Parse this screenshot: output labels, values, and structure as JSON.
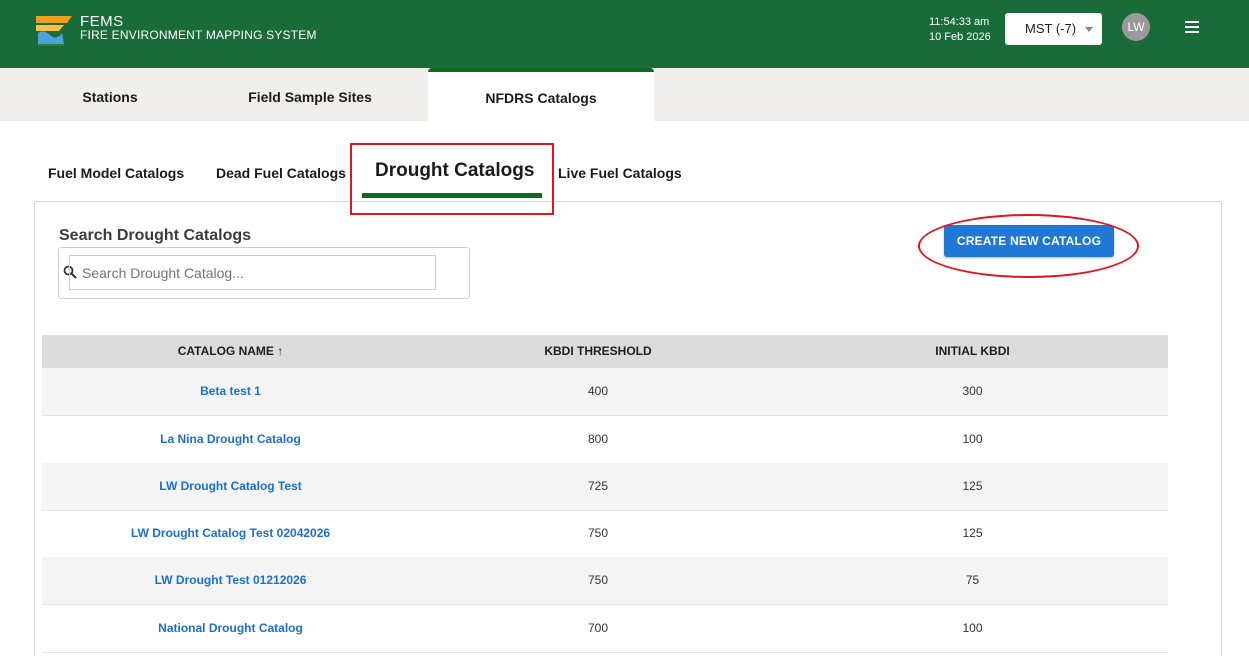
{
  "app": {
    "acronym": "FEMS",
    "full_name": "FIRE ENVIRONMENT MAPPING SYSTEM",
    "time": "11:54:33 am",
    "date": "10 Feb 2026",
    "timezone": "MST (-7)",
    "user_initials": "LW",
    "colors": {
      "header": "#1a6b3a",
      "accent": "#0b6b1f",
      "button": "#1f77d6",
      "link": "#1d6fce",
      "highlight": "#e0161c"
    }
  },
  "top_tabs": [
    "Stations",
    "Field Sample Sites",
    "NFDRS Catalogs"
  ],
  "sub_tabs": [
    "Fuel Model Catalogs",
    "Dead Fuel Catalogs",
    "Drought Catalogs",
    "Live Fuel Catalogs"
  ],
  "search": {
    "title": "Search Drought Catalogs",
    "placeholder": "Search Drought Catalog..."
  },
  "create_button": "CREATE NEW CATALOG",
  "table": {
    "headers": [
      "CATALOG NAME ↑",
      "KBDI THRESHOLD",
      "INITIAL KBDI"
    ],
    "rows": [
      {
        "name": "Beta test 1",
        "threshold": "400",
        "initial": "300"
      },
      {
        "name": "La Nina Drought Catalog",
        "threshold": "800",
        "initial": "100"
      },
      {
        "name": "LW Drought Catalog Test",
        "threshold": "725",
        "initial": "125"
      },
      {
        "name": "LW Drought Catalog Test 02042026",
        "threshold": "750",
        "initial": "125"
      },
      {
        "name": "LW Drought Test 01212026",
        "threshold": "750",
        "initial": "75"
      },
      {
        "name": "National Drought Catalog",
        "threshold": "700",
        "initial": "100"
      }
    ]
  }
}
